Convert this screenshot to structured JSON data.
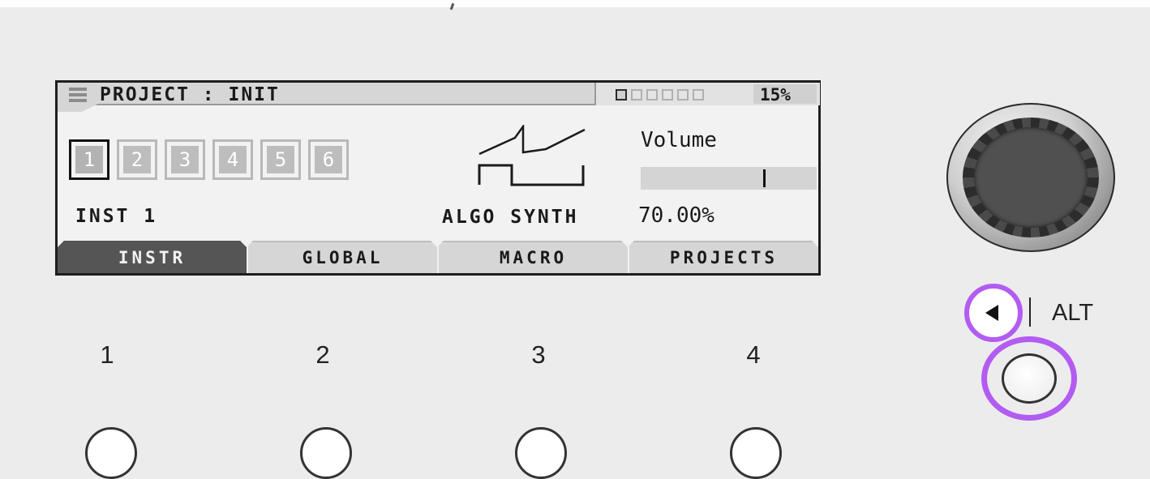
{
  "lcd": {
    "title": "PROJECT : INIT",
    "pages": {
      "total": 6,
      "active": 1
    },
    "cpu": "15%",
    "instrument_slots": [
      {
        "label": "1",
        "selected": true
      },
      {
        "label": "2",
        "selected": false
      },
      {
        "label": "3",
        "selected": false
      },
      {
        "label": "4",
        "selected": false
      },
      {
        "label": "5",
        "selected": false
      },
      {
        "label": "6",
        "selected": false
      }
    ],
    "instrument_name": "INST 1",
    "engine_name": "ALGO SYNTH",
    "engine_icon": "saw-and-square-wave-icon",
    "parameter": {
      "name": "Volume",
      "value": "70.00%",
      "level_fraction": 0.7
    },
    "tabs": [
      {
        "label": "INSTR",
        "active": true
      },
      {
        "label": "GLOBAL",
        "active": false
      },
      {
        "label": "MACRO",
        "active": false
      },
      {
        "label": "PROJECTS",
        "active": false
      }
    ]
  },
  "hardware": {
    "knob_labels": [
      "1",
      "2",
      "3",
      "4"
    ],
    "alt_label": "ALT",
    "back_icon": "left-triangle-icon",
    "highlight_color": "#b25cf2"
  }
}
